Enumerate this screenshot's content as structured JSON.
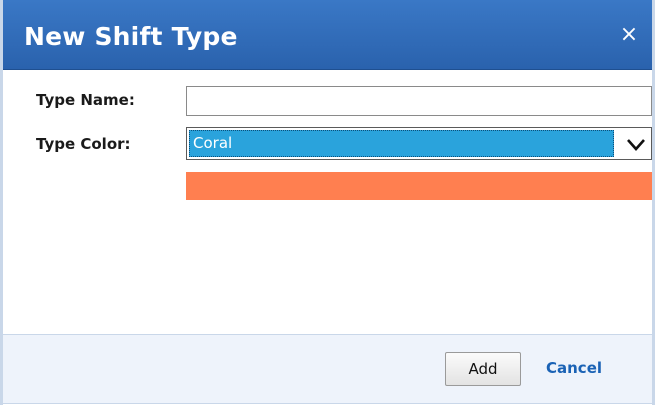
{
  "dialog": {
    "title": "New Shift Type",
    "close_glyph": "×"
  },
  "form": {
    "type_name_label": "Type Name:",
    "type_name_value": "",
    "type_color_label": "Type Color:",
    "type_color_selected": "Coral",
    "swatch_color": "#ff7f50"
  },
  "footer": {
    "add_label": "Add",
    "cancel_label": "Cancel"
  },
  "colors": {
    "title_bar": "#2f6bb8",
    "selection_highlight": "#2aa3dc",
    "footer_background": "#eef3fb",
    "link": "#1a62b5"
  }
}
